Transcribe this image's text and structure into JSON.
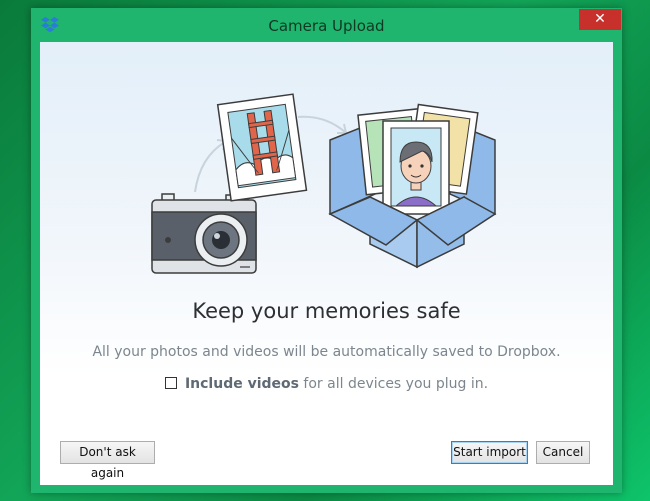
{
  "window": {
    "title": "Camera Upload",
    "close_glyph": "✕",
    "app_icon": "dropbox-icon"
  },
  "content": {
    "heading": "Keep your memories safe",
    "subtitle": "All your photos and videos will be automatically saved to Dropbox.",
    "checkbox": {
      "checked": false,
      "bold_label": "Include videos",
      "rest_label": " for all devices you plug in."
    }
  },
  "buttons": {
    "dont_ask": "Don't ask again",
    "start_import": "Start import",
    "cancel": "Cancel"
  },
  "colors": {
    "window_frame": "#1fb56e",
    "close_button": "#c7302b",
    "dropbox_blue": "#3d8ae0"
  }
}
